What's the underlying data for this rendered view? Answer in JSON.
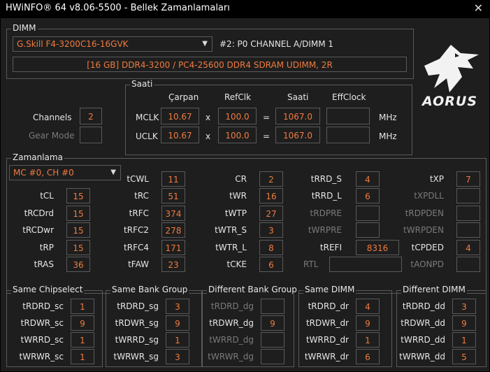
{
  "title": "HWiNFO® 64 v8.06-5500 - Bellek Zamanlamaları",
  "dimm": {
    "legend": "DIMM",
    "module": "G.Skill F4-3200C16-16GVK",
    "slot": "#2: P0 CHANNEL A/DIMM 1",
    "desc": "[16 GB] DDR4-3200 / PC4-25600 DDR4 SDRAM UDIMM, 2R"
  },
  "brand": "AORUS",
  "channels": {
    "label": "Channels",
    "value": "2"
  },
  "gear_mode": {
    "label": "Gear Mode",
    "value": ""
  },
  "saati": {
    "legend": "Saati",
    "headers": {
      "carpan": "Çarpan",
      "refclk": "RefClk",
      "saati": "Saati",
      "effclock": "EffClock"
    },
    "mclk": {
      "label": "MCLK",
      "mult": "10.67",
      "ref": "100.0",
      "clock": "1067.0",
      "eff": "",
      "unit": "MHz"
    },
    "uclk": {
      "label": "UCLK",
      "mult": "10.67",
      "ref": "100.0",
      "clock": "1067.0",
      "eff": "",
      "unit": "MHz"
    },
    "x": "x",
    "eq": "="
  },
  "zaman": {
    "legend": "Zamanlama",
    "select": "MC #0, CH #0",
    "tCL": {
      "label": "tCL",
      "value": "15"
    },
    "tRCDrd": {
      "label": "tRCDrd",
      "value": "15"
    },
    "tRCDwr": {
      "label": "tRCDwr",
      "value": "15"
    },
    "tRP": {
      "label": "tRP",
      "value": "15"
    },
    "tRAS": {
      "label": "tRAS",
      "value": "36"
    },
    "tCWL": {
      "label": "tCWL",
      "value": "11"
    },
    "tRC": {
      "label": "tRC",
      "value": "51"
    },
    "tRFC": {
      "label": "tRFC",
      "value": "374"
    },
    "tRFC2": {
      "label": "tRFC2",
      "value": "278"
    },
    "tRFC4": {
      "label": "tRFC4",
      "value": "171"
    },
    "tFAW": {
      "label": "tFAW",
      "value": "23"
    },
    "CR": {
      "label": "CR",
      "value": "2"
    },
    "tWR": {
      "label": "tWR",
      "value": "16"
    },
    "tWTP": {
      "label": "tWTP",
      "value": "27"
    },
    "tWTR_S": {
      "label": "tWTR_S",
      "value": "3"
    },
    "tWTR_L": {
      "label": "tWTR_L",
      "value": "8"
    },
    "tCKE": {
      "label": "tCKE",
      "value": "6"
    },
    "tRRD_S": {
      "label": "tRRD_S",
      "value": "4"
    },
    "tRRD_L": {
      "label": "tRRD_L",
      "value": "6"
    },
    "tRDPRE": {
      "label": "tRDPRE",
      "value": ""
    },
    "tWRPRE": {
      "label": "tWRPRE",
      "value": ""
    },
    "tREFI": {
      "label": "tREFI",
      "value": "8316"
    },
    "RTL": {
      "label": "RTL",
      "value": ""
    },
    "tXP": {
      "label": "tXP",
      "value": "7"
    },
    "tXPDLL": {
      "label": "tXPDLL",
      "value": ""
    },
    "tRDPDEN": {
      "label": "tRDPDEN",
      "value": ""
    },
    "tWRPDEN": {
      "label": "tWRPDEN",
      "value": ""
    },
    "tCPDED": {
      "label": "tCPDED",
      "value": "4"
    },
    "tAONPD": {
      "label": "tAONPD",
      "value": ""
    }
  },
  "groups": {
    "sc": {
      "legend": "Same Chipselect",
      "rows": [
        [
          "tRDRD_sc",
          "1"
        ],
        [
          "tRDWR_sc",
          "9"
        ],
        [
          "tWRRD_sc",
          "1"
        ],
        [
          "tWRWR_sc",
          "1"
        ]
      ]
    },
    "sg": {
      "legend": "Same Bank Group",
      "rows": [
        [
          "tRDRD_sg",
          "3"
        ],
        [
          "tRDWR_sg",
          "9"
        ],
        [
          "tWRRD_sg",
          "1"
        ],
        [
          "tWRWR_sg",
          "3"
        ]
      ]
    },
    "dg": {
      "legend": "Different Bank Group",
      "rows": [
        [
          "tRDRD_dg",
          ""
        ],
        [
          "tRDWR_dg",
          "9"
        ],
        [
          "tWRRD_dg",
          ""
        ],
        [
          "tWRWR_dg",
          ""
        ]
      ]
    },
    "dr": {
      "legend": "Same DIMM",
      "rows": [
        [
          "tRDRD_dr",
          "4"
        ],
        [
          "tRDWR_dr",
          "9"
        ],
        [
          "tWRRD_dr",
          "1"
        ],
        [
          "tWRWR_dr",
          "6"
        ]
      ]
    },
    "dd": {
      "legend": "Different DIMM",
      "rows": [
        [
          "tRDRD_dd",
          "3"
        ],
        [
          "tRDWR_dd",
          "9"
        ],
        [
          "tWRRD_dd",
          "1"
        ],
        [
          "tWRWR_dd",
          "5"
        ]
      ]
    }
  }
}
